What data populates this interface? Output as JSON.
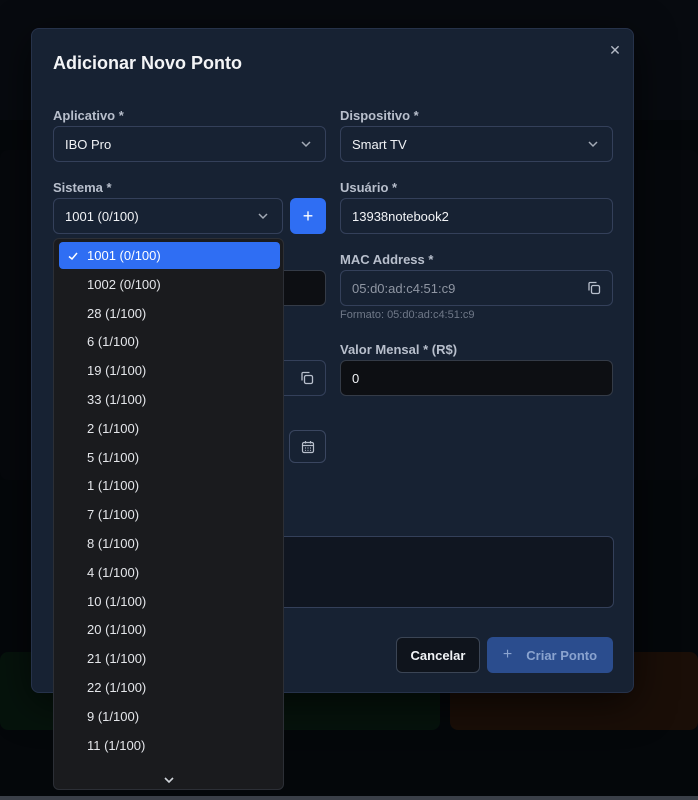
{
  "modal": {
    "title": "Adicionar Novo Ponto",
    "close_symbol": "✕"
  },
  "form": {
    "aplicativo": {
      "label": "Aplicativo *",
      "value": "IBO Pro"
    },
    "dispositivo": {
      "label": "Dispositivo *",
      "value": "Smart TV"
    },
    "sistema": {
      "label": "Sistema *",
      "value": "1001 (0/100)"
    },
    "add_symbol": "+",
    "usuario": {
      "label": "Usuário *",
      "value": "13938notebook2"
    },
    "mac": {
      "label": "MAC Address *",
      "value": "05:d0:ad:c4:51:c9",
      "hint": "Formato: 05:d0:ad:c4:51:c9"
    },
    "valor": {
      "label": "Valor Mensal * (R$)",
      "value": "0"
    }
  },
  "actions": {
    "cancel": "Cancelar",
    "create": "Criar Ponto",
    "create_icon": "+"
  },
  "dropdown": {
    "selected_index": 0,
    "options": [
      "1001 (0/100)",
      "1002 (0/100)",
      "28 (1/100)",
      "6 (1/100)",
      "19 (1/100)",
      "33 (1/100)",
      "2 (1/100)",
      "5 (1/100)",
      "1 (1/100)",
      "7 (1/100)",
      "8 (1/100)",
      "4 (1/100)",
      "10 (1/100)",
      "20 (1/100)",
      "21 (1/100)",
      "22 (1/100)",
      "9 (1/100)",
      "11 (1/100)"
    ]
  },
  "colors": {
    "accent": "#2f6ef3",
    "modal_bg": "#172233",
    "dropdown_bg": "#1a1b1e"
  },
  "icons": [
    "close-icon",
    "chevron-down-icon",
    "copy-icon",
    "calendar-icon",
    "check-icon",
    "plus-icon"
  ]
}
